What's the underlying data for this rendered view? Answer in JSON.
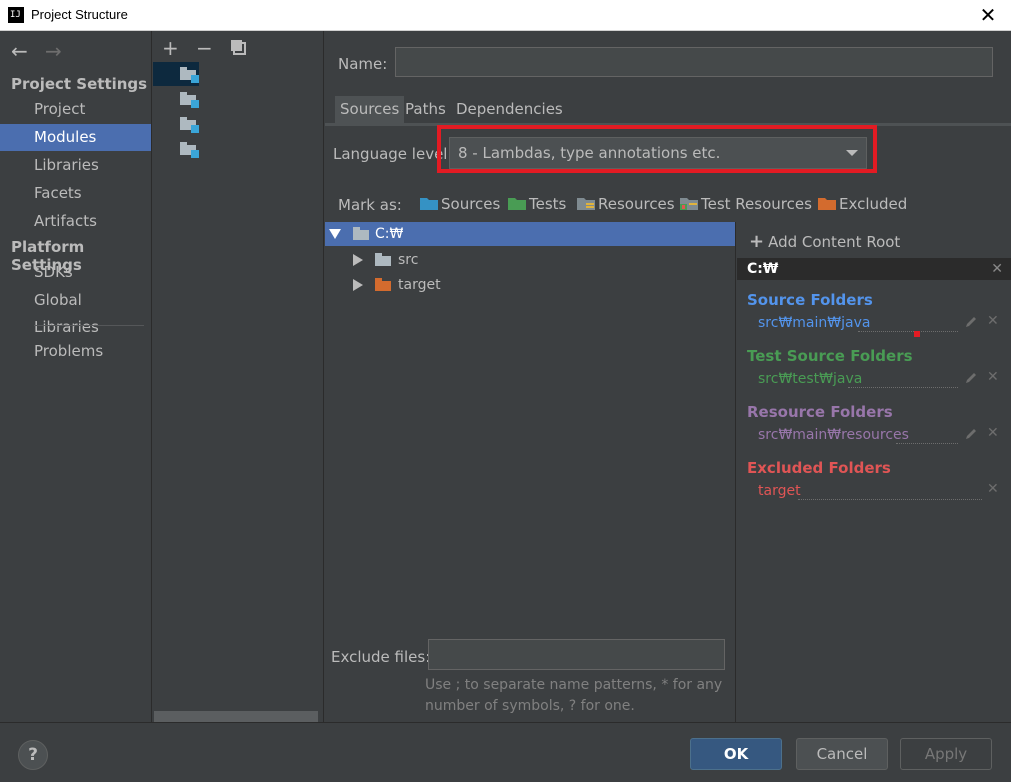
{
  "window": {
    "title": "Project Structure",
    "close_glyph": "✕",
    "app_icon_text": "IJ"
  },
  "nav": {
    "back_glyph": "←",
    "forward_glyph": "→",
    "section_project_settings": "Project Settings",
    "project": "Project",
    "modules": "Modules",
    "libraries": "Libraries",
    "facets": "Facets",
    "artifacts": "Artifacts",
    "section_platform_settings": "Platform Settings",
    "sdks": "SDKs",
    "global_libraries": "Global Libraries",
    "problems": "Problems"
  },
  "toolbar": {
    "add_glyph": "+",
    "remove_glyph": "−"
  },
  "module": {
    "name_label": "Name:",
    "name_value": "",
    "tabs": {
      "sources": "Sources",
      "paths": "Paths",
      "dependencies": "Dependencies"
    },
    "language_level_label": "Language level:",
    "language_level_value": "8 - Lambdas, type annotations etc.",
    "mark_as_label": "Mark as:",
    "mark_sources": "Sources",
    "mark_tests": "Tests",
    "mark_resources": "Resources",
    "mark_test_resources": "Test Resources",
    "mark_excluded": "Excluded"
  },
  "tree": {
    "root": "C:₩",
    "src": "src",
    "target": "target"
  },
  "roots": {
    "add_content_root": "Add Content Root",
    "content_root": "C:₩",
    "source_folders_label": "Source Folders",
    "source_folder": "src₩main₩java",
    "test_source_folders_label": "Test Source Folders",
    "test_source_folder": "src₩test₩java",
    "resource_folders_label": "Resource Folders",
    "resource_folder": "src₩main₩resources",
    "excluded_folders_label": "Excluded Folders",
    "excluded_folder": "target"
  },
  "exclude": {
    "label": "Exclude files:",
    "value": "",
    "hint_line1": "Use ; to separate name patterns, * for any",
    "hint_line2": "number of symbols, ? for one."
  },
  "footer": {
    "help": "?",
    "ok": "OK",
    "cancel": "Cancel",
    "apply": "Apply"
  },
  "colors": {
    "selection": "#4b6eaf",
    "sources": "#5394ec",
    "tests": "#499c54",
    "resources": "#9876aa",
    "excluded": "#e05555",
    "highlight": "#e31b23"
  }
}
